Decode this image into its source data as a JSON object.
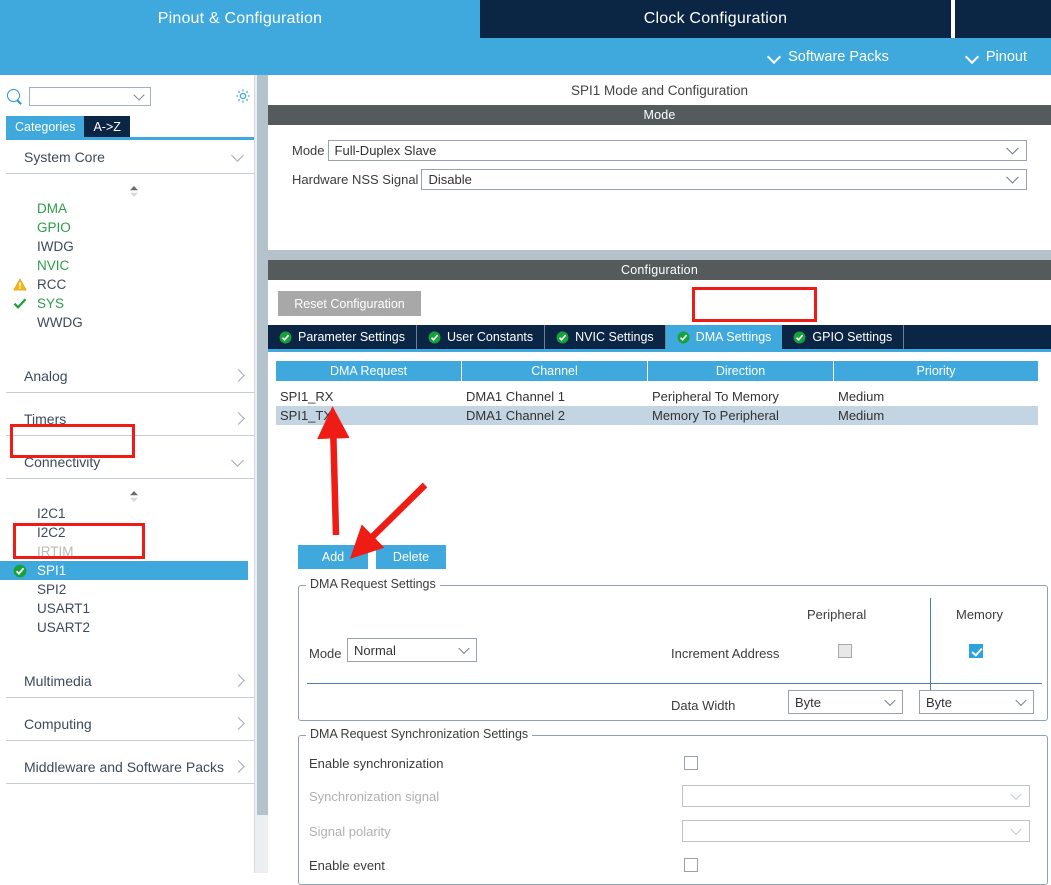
{
  "header": {
    "tabs": [
      {
        "label": "Pinout & Configuration",
        "active": true
      },
      {
        "label": "Clock Configuration",
        "active": false
      },
      {
        "label": "",
        "active": false
      }
    ],
    "sub_items": [
      {
        "label": "Software Packs",
        "icon": "chevron-down-icon"
      },
      {
        "label": "Pinout",
        "icon": "chevron-down-icon"
      }
    ]
  },
  "sidebar": {
    "search": {
      "value": "",
      "placeholder": "",
      "icon": "search-icon"
    },
    "gear_icon": "gear-icon",
    "view_tabs": [
      {
        "label": "Categories",
        "selected": true
      },
      {
        "label": "A->Z",
        "selected": false
      }
    ],
    "groups": [
      {
        "label": "System Core",
        "expanded": true,
        "items": [
          {
            "label": "DMA",
            "state": "configured",
            "icon": ""
          },
          {
            "label": "GPIO",
            "state": "configured",
            "icon": ""
          },
          {
            "label": "IWDG",
            "state": "normal",
            "icon": ""
          },
          {
            "label": "NVIC",
            "state": "configured",
            "icon": ""
          },
          {
            "label": "RCC",
            "state": "normal",
            "icon": "warning-icon"
          },
          {
            "label": "SYS",
            "state": "configured",
            "icon": "check-icon"
          },
          {
            "label": "WWDG",
            "state": "normal",
            "icon": ""
          }
        ]
      },
      {
        "label": "Analog",
        "expanded": false,
        "items": []
      },
      {
        "label": "Timers",
        "expanded": false,
        "items": []
      },
      {
        "label": "Connectivity",
        "expanded": true,
        "items": [
          {
            "label": "I2C1",
            "state": "normal",
            "icon": ""
          },
          {
            "label": "I2C2",
            "state": "normal",
            "icon": ""
          },
          {
            "label": "IRTIM",
            "state": "disabled",
            "icon": ""
          },
          {
            "label": "SPI1",
            "state": "selected",
            "icon": "check-circle-icon"
          },
          {
            "label": "SPI2",
            "state": "normal",
            "icon": ""
          },
          {
            "label": "USART1",
            "state": "normal",
            "icon": ""
          },
          {
            "label": "USART2",
            "state": "normal",
            "icon": ""
          }
        ]
      },
      {
        "label": "Multimedia",
        "expanded": false,
        "items": []
      },
      {
        "label": "Computing",
        "expanded": false,
        "items": []
      },
      {
        "label": "Middleware and Software Packs",
        "expanded": false,
        "items": []
      }
    ]
  },
  "main": {
    "panel_title": "SPI1 Mode and Configuration",
    "mode_band": "Mode",
    "mode_fields": [
      {
        "label": "Mode",
        "value": "Full-Duplex Slave"
      },
      {
        "label": "Hardware NSS Signal",
        "value": "Disable"
      }
    ],
    "config_band": "Configuration",
    "reset_button": "Reset Configuration",
    "tabs": [
      {
        "label": "Parameter Settings",
        "active": false,
        "icon": "check-circle-icon"
      },
      {
        "label": "User Constants",
        "active": false,
        "icon": "check-circle-icon"
      },
      {
        "label": "NVIC Settings",
        "active": false,
        "icon": "check-circle-icon"
      },
      {
        "label": "DMA Settings",
        "active": true,
        "icon": "check-circle-icon"
      },
      {
        "label": "GPIO Settings",
        "active": false,
        "icon": "check-circle-icon"
      }
    ],
    "dma_table": {
      "columns": [
        "DMA Request",
        "Channel",
        "Direction",
        "Priority"
      ],
      "rows": [
        {
          "cells": [
            "SPI1_RX",
            "DMA1 Channel 1",
            "Peripheral To Memory",
            "Medium"
          ],
          "selected": false
        },
        {
          "cells": [
            "SPI1_TX",
            "DMA1 Channel 2",
            "Memory To Peripheral",
            "Medium"
          ],
          "selected": true
        }
      ]
    },
    "buttons": {
      "add": "Add",
      "delete": "Delete"
    },
    "request_settings": {
      "legend": "DMA Request Settings",
      "col_peripheral": "Peripheral",
      "col_memory": "Memory",
      "mode_label": "Mode",
      "mode_value": "Normal",
      "increment_label": "Increment Address",
      "increment_peripheral": false,
      "increment_memory": true,
      "data_width_label": "Data Width",
      "data_width_peripheral": "Byte",
      "data_width_memory": "Byte"
    },
    "sync_settings": {
      "legend": "DMA Request Synchronization Settings",
      "enable_sync_label": "Enable synchronization",
      "enable_sync_checked": false,
      "sync_signal_label": "Synchronization signal",
      "sync_signal_value": "",
      "signal_polarity_label": "Signal polarity",
      "signal_polarity_value": "",
      "enable_event_label": "Enable event",
      "enable_event_checked": false
    }
  },
  "annotations": {
    "highlight_color": "#ee1c15",
    "boxes": [
      "connectivity-group",
      "spi1-item",
      "dma-settings-tab"
    ],
    "arrows": [
      "arrow-to-dma-table",
      "arrow-to-add-button"
    ]
  },
  "colors": {
    "accent_blue": "#3fa9dd",
    "dark_navy": "#0b2545",
    "band_gray": "#555a5c",
    "green": "#2e9c4a",
    "selection_row": "#c3d4e3"
  }
}
